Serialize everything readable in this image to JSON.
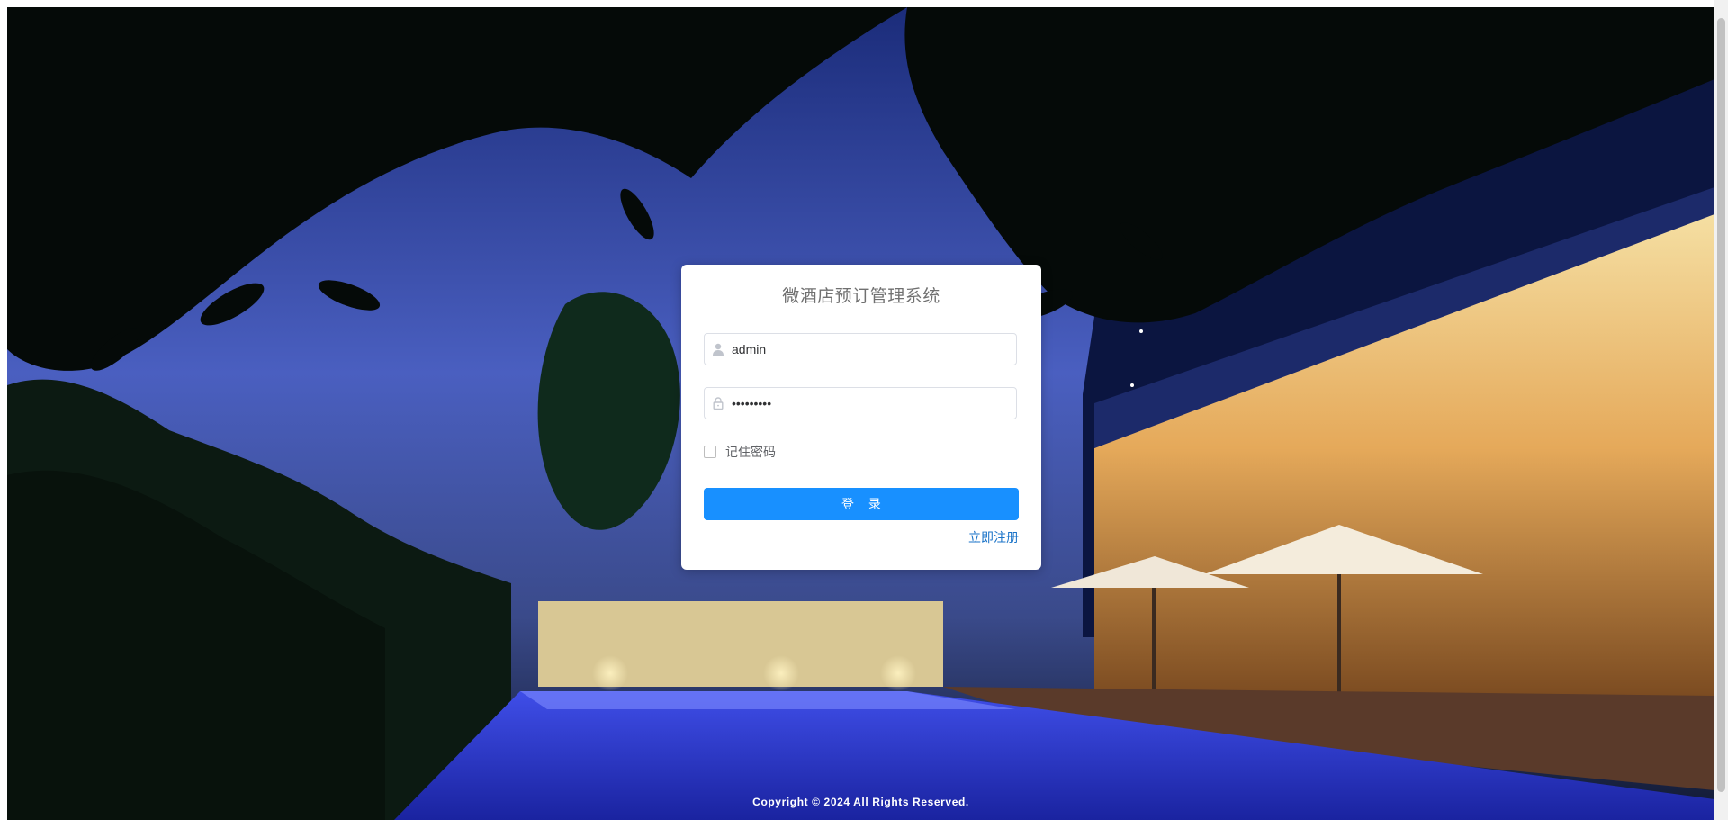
{
  "login": {
    "title": "微酒店预订管理系统",
    "username_value": "admin",
    "password_value": "•••••••••",
    "remember_label": "记住密码",
    "remember_checked": false,
    "submit_label": "登 录",
    "register_link": "立即注册"
  },
  "footer": {
    "copyright": "Copyright © 2024 All Rights Reserved."
  },
  "icons": {
    "username": "user-icon",
    "password": "lock-icon"
  },
  "colors": {
    "primary": "#1890ff",
    "link": "#1a73c8",
    "card_bg": "#ffffff",
    "title": "#707070"
  }
}
